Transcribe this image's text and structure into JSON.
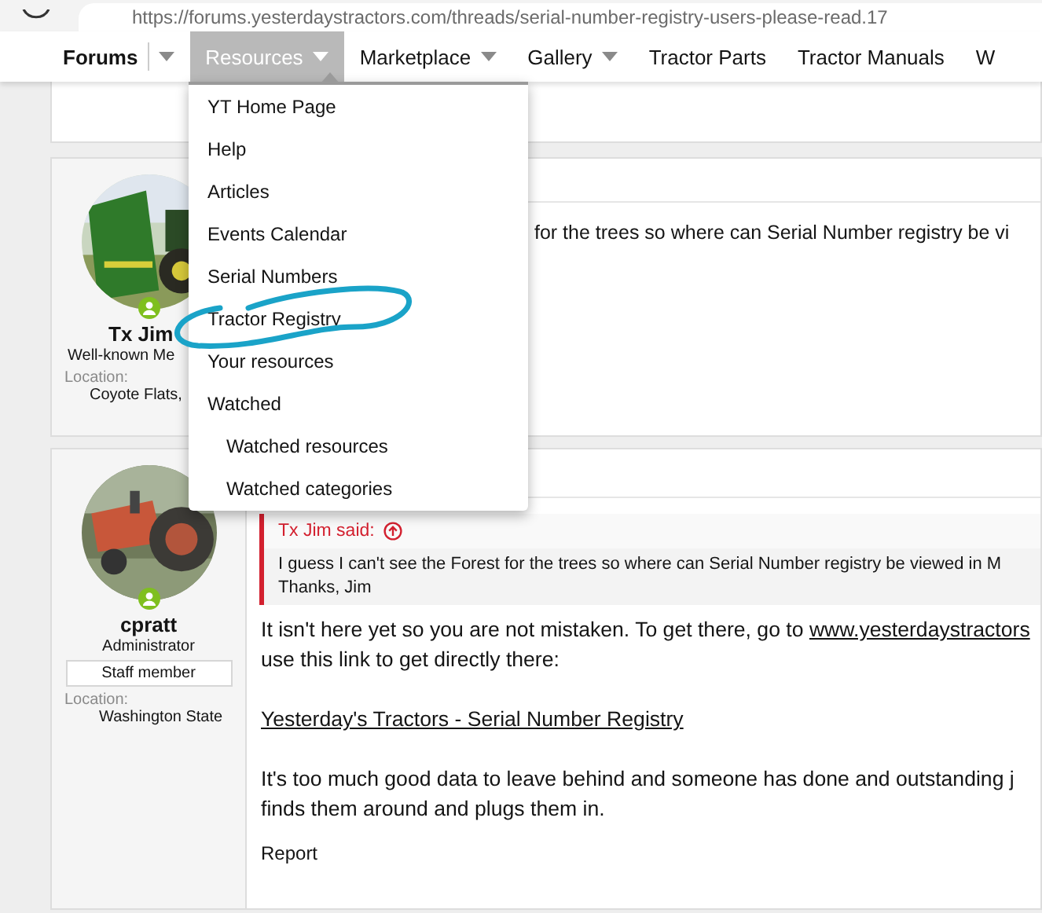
{
  "browser": {
    "address": "https://forums.yesterdaystractors.com/threads/serial-number-registry-users-please-read.17"
  },
  "nav": {
    "tabs": [
      {
        "label": "Forums",
        "selected": false,
        "dropdown": true,
        "bold": true
      },
      {
        "label": "Resources",
        "selected": true,
        "dropdown": true,
        "bold": false
      },
      {
        "label": "Marketplace",
        "selected": false,
        "dropdown": true,
        "bold": false
      },
      {
        "label": "Gallery",
        "selected": false,
        "dropdown": true,
        "bold": false
      },
      {
        "label": "Tractor Parts",
        "selected": false,
        "dropdown": false,
        "bold": false
      },
      {
        "label": "Tractor Manuals",
        "selected": false,
        "dropdown": false,
        "bold": false
      },
      {
        "label": "W",
        "selected": false,
        "dropdown": false,
        "bold": false
      }
    ]
  },
  "menu": {
    "items": [
      {
        "label": "YT Home Page"
      },
      {
        "label": "Help"
      },
      {
        "label": "Articles"
      },
      {
        "label": "Events Calendar"
      },
      {
        "label": "Serial Numbers"
      },
      {
        "label": "Tractor Registry",
        "circled": true
      },
      {
        "label": "Your resources"
      },
      {
        "label": "Watched",
        "children": [
          {
            "label": "Watched resources"
          },
          {
            "label": "Watched categories"
          }
        ]
      }
    ]
  },
  "posts": [
    {
      "user": {
        "name": "Tx Jim",
        "title": "Well-known Me",
        "location_label": "Location:",
        "location": "Coyote Flats,",
        "online": true
      },
      "body": [
        {
          "kind": "text",
          "text": "for the trees so where can Serial Number registry be vi"
        }
      ]
    },
    {
      "user": {
        "name": "cpratt",
        "title": "Administrator",
        "badge": "Staff member",
        "location_label": "Location:",
        "location": "Washington State",
        "online": true
      },
      "quote": {
        "author": "Tx Jim said:",
        "lines": [
          "I guess I can't see the Forest for the trees so where can Serial Number registry be viewed in M",
          "Thanks, Jim"
        ]
      },
      "body": [
        {
          "kind": "text",
          "text": "It isn't here yet so you are not mistaken. To get there, go to ",
          "link": "www.yesterdaystractors"
        },
        {
          "kind": "text",
          "text": "use this link to get directly there:"
        },
        {
          "kind": "link",
          "text": "Yesterday's Tractors - Serial Number Registry"
        },
        {
          "kind": "text",
          "text": "It's too much good data to leave behind and someone has done and outstanding j"
        },
        {
          "kind": "text",
          "text": "finds them around and plugs them in."
        }
      ],
      "actions": [
        "Report"
      ]
    }
  ]
}
